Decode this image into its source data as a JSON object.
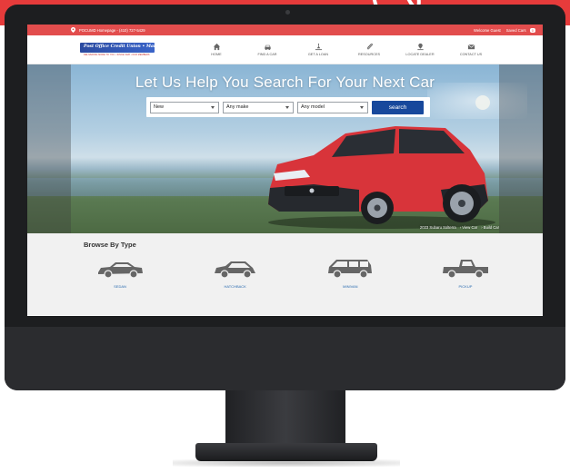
{
  "topbar": {
    "homepage_link": "POCUMD Homepage",
    "phone": "(410) 727-5429",
    "welcome": "Welcome Guest",
    "saved_cars": "Saved Cars",
    "saved_count": "0"
  },
  "brand": {
    "logo_text": "Post Office Credit Union • Maryland",
    "logo_tagline": "DELIVERING MORE TO YOU • SINCE 1928 • OUR MEMBERS"
  },
  "nav": {
    "items": [
      {
        "label": "HOME",
        "icon": "home-icon"
      },
      {
        "label": "FIND A CAR",
        "icon": "car-icon"
      },
      {
        "label": "GET A LOAN",
        "icon": "loan-icon"
      },
      {
        "label": "RESOURCES",
        "icon": "paperclip-icon"
      },
      {
        "label": "LOCATE DEALER",
        "icon": "dealer-pin-icon"
      },
      {
        "label": "CONTACT US",
        "icon": "envelope-icon"
      }
    ]
  },
  "hero": {
    "title": "Let Us Help You Search For Your Next Car",
    "condition": "New",
    "make": "Any make",
    "model": "Any model",
    "search_label": "search",
    "caption_model": "2023 Subaru Solterra",
    "caption_view": "› View Car",
    "caption_build": "› Build Car"
  },
  "browse": {
    "title": "Browse By Type",
    "types": [
      {
        "label": "SEDAN",
        "icon": "sedan-icon"
      },
      {
        "label": "HATCHBACK",
        "icon": "hatchback-icon"
      },
      {
        "label": "MINIVAN",
        "icon": "minivan-icon"
      },
      {
        "label": "PICKUP",
        "icon": "pickup-icon"
      }
    ]
  },
  "colors": {
    "topbar": "#e24d4d",
    "search_button": "#17489c",
    "car_body": "#d8343a",
    "type_label": "#2b6cb0"
  }
}
